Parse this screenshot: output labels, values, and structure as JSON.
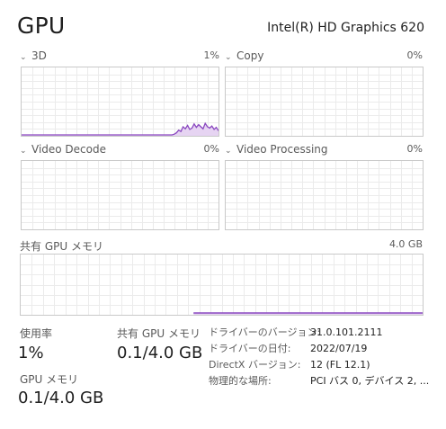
{
  "header": {
    "title": "GPU",
    "adapter_name": "Intel(R) HD Graphics 620"
  },
  "engines": [
    {
      "label": "3D",
      "percent": "1%",
      "activity": [
        0,
        0,
        0,
        0,
        0,
        0,
        0,
        0,
        0,
        0,
        0,
        0,
        0,
        0,
        0,
        0,
        0,
        0,
        0,
        0,
        0,
        0,
        0,
        0,
        0,
        0,
        0,
        0,
        0,
        0,
        0,
        0,
        0,
        0,
        0,
        0,
        0,
        0,
        0,
        0,
        0,
        0,
        0,
        0,
        0,
        0,
        0,
        0,
        0,
        0,
        0,
        0,
        0,
        0,
        0,
        0,
        0,
        0,
        0,
        0,
        0,
        0,
        0,
        0,
        0,
        0,
        0,
        0,
        0,
        1,
        3,
        7,
        5,
        12,
        9,
        14,
        8,
        10,
        16,
        11,
        15,
        12,
        9,
        17,
        12,
        10,
        13,
        8,
        11,
        6
      ]
    },
    {
      "label": "Copy",
      "percent": "0%",
      "activity": []
    },
    {
      "label": "Video Decode",
      "percent": "0%",
      "activity": []
    },
    {
      "label": "Video Processing",
      "percent": "0%",
      "activity": []
    }
  ],
  "shared_memory": {
    "label": "共有 GPU メモリ",
    "max": "4.0 GB",
    "usage_fraction": 0.025,
    "usage_start_fraction": 0.43
  },
  "stats": {
    "utilization_label": "使用率",
    "utilization_value": "1%",
    "shared_mem_label": "共有 GPU メモリ",
    "shared_mem_value": "0.1/4.0 GB",
    "gpu_mem_label": "GPU メモリ",
    "gpu_mem_value": "0.1/4.0 GB"
  },
  "info": [
    {
      "key": "ドライバーのバージョン:",
      "value": "31.0.101.2111"
    },
    {
      "key": "ドライバーの日付:",
      "value": "2022/07/19"
    },
    {
      "key": "DirectX バージョン:",
      "value": "12 (FL 12.1)"
    },
    {
      "key": "物理的な場所:",
      "value": "PCI バス 0, デバイス 2, ..."
    }
  ],
  "colors": {
    "line": "#8a48c0",
    "fill": "#e6d4f2",
    "grid": "#ebebeb"
  }
}
